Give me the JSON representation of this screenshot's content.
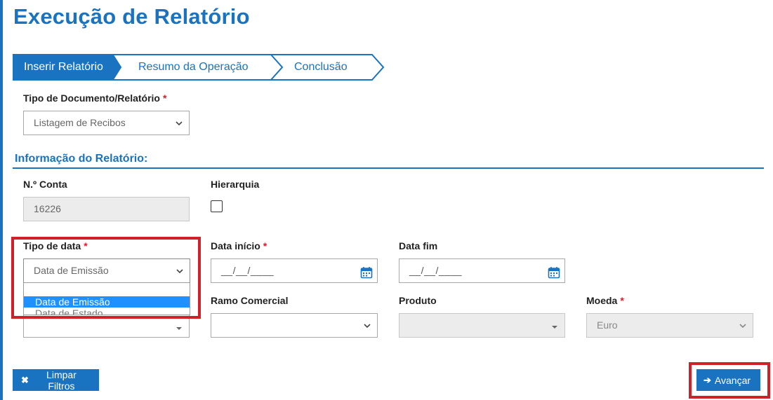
{
  "page": {
    "title": "Execução de Relatório"
  },
  "steps": [
    {
      "label": "Inserir Relatório",
      "active": true
    },
    {
      "label": "Resumo da Operação",
      "active": false
    },
    {
      "label": "Conclusão",
      "active": false
    }
  ],
  "doc_type": {
    "label": "Tipo de Documento/Relatório",
    "required_mark": "*",
    "value": "Listagem de Recibos"
  },
  "section": {
    "title": "Informação do Relatório:"
  },
  "account": {
    "label": "N.º Conta",
    "value": "16226"
  },
  "hierarchy": {
    "label": "Hierarquia",
    "checked": false
  },
  "date_type": {
    "label": "Tipo de data",
    "required_mark": "*",
    "value": "Data de Emissão",
    "options": [
      "Data de Emissão",
      "Data de Estado"
    ],
    "selected_option": "Data de Emissão"
  },
  "date_start": {
    "label": "Data início",
    "required_mark": "*",
    "placeholder": "__/__/____"
  },
  "date_end": {
    "label": "Data fim",
    "placeholder": "__/__/____"
  },
  "commercial_branch": {
    "label": "Ramo Comercial",
    "value": ""
  },
  "product": {
    "label": "Produto",
    "value": ""
  },
  "currency": {
    "label": "Moeda",
    "required_mark": "*",
    "value": "Euro"
  },
  "buttons": {
    "clear": "Limpar Filtros",
    "next": "Avançar"
  },
  "colors": {
    "brand": "#1a73c0",
    "highlight": "#d0202a",
    "option_selected": "#1e90ff"
  },
  "icons": {
    "clear": "times-icon",
    "next": "arrow-right-icon",
    "calendar": "calendar-icon"
  }
}
